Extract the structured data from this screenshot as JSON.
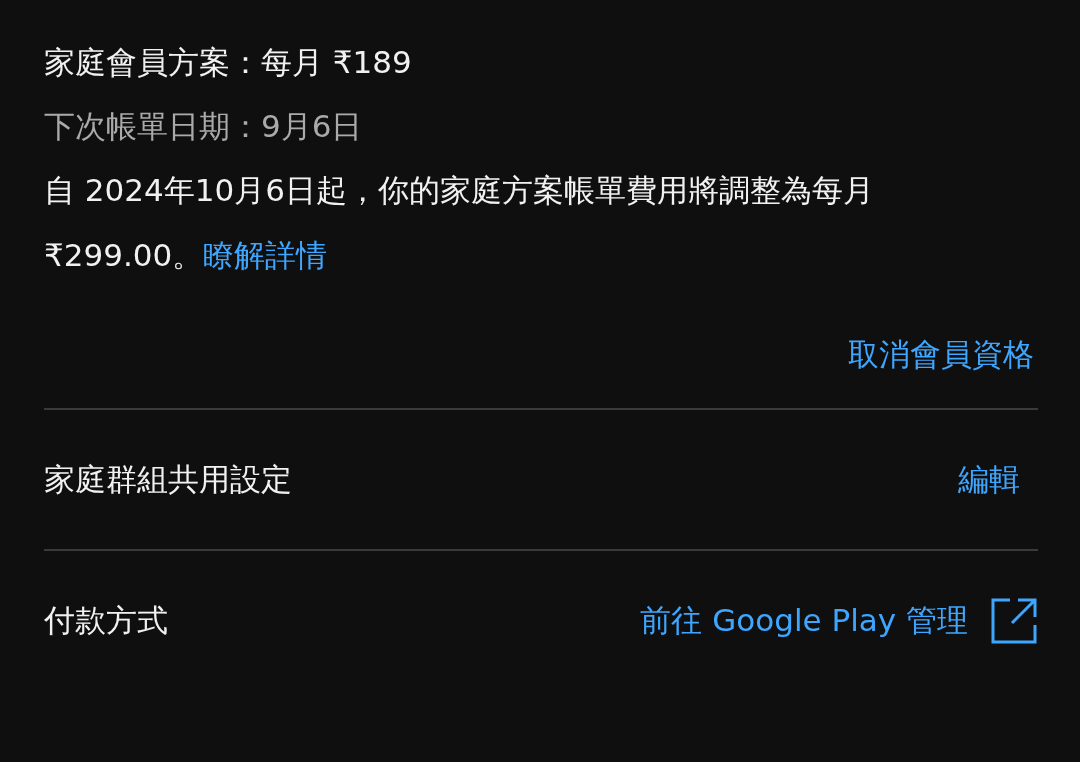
{
  "plan": {
    "title": "家庭會員方案：每月 ₹189",
    "next_billing": "下次帳單日期：9月6日",
    "notice": "自 2024年10月6日起，你的家庭方案帳單費用將調整為每月 ₹299.00。",
    "notice_link": "瞭解詳情",
    "cancel_link": "取消會員資格"
  },
  "settings": [
    {
      "label": "家庭群組共用設定",
      "action": "編輯",
      "kind": "edit"
    },
    {
      "label": "付款方式",
      "action": "前往 Google Play 管理",
      "kind": "external"
    }
  ]
}
